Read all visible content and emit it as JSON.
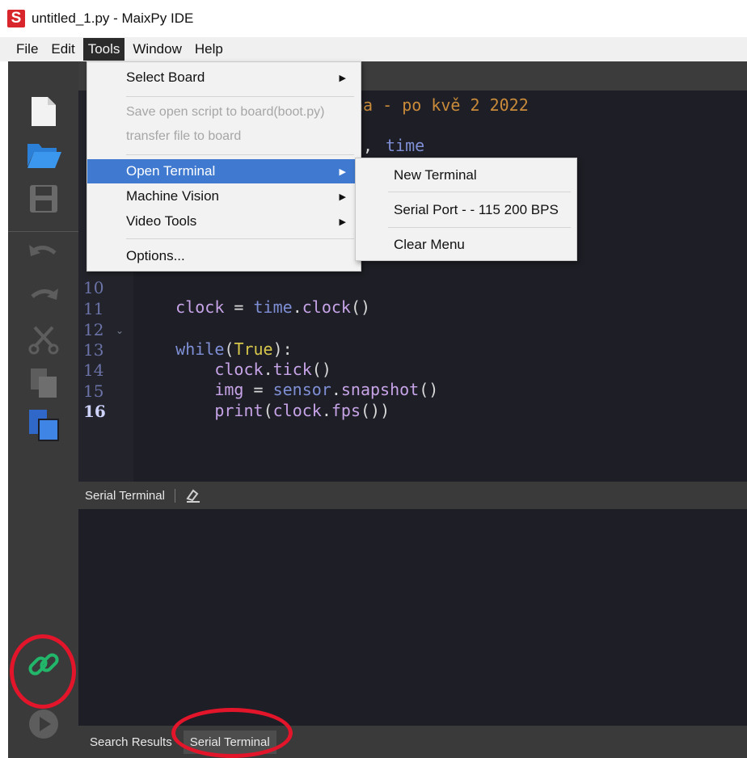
{
  "window": {
    "title": "untitled_1.py - MaixPy IDE",
    "logo_letter": "S"
  },
  "menubar": {
    "items": [
      "File",
      "Edit",
      "Tools",
      "Window",
      "Help"
    ],
    "active": "Tools"
  },
  "tools_menu": {
    "select_board": "Select Board",
    "save_script": "Save open script to board(boot.py)",
    "transfer_file": "transfer file to board",
    "open_terminal": "Open Terminal",
    "machine_vision": "Machine Vision",
    "video_tools": "Video Tools",
    "options": "Options..."
  },
  "terminal_submenu": {
    "new_terminal": "New Terminal",
    "serial_port": "Serial Port -  - 115 200 BPS",
    "clear_menu": "Clear Menu"
  },
  "editor": {
    "partial_comment": "ha - po kvě 2 2022",
    "partial_import_sep": ",",
    "partial_import_mod": "time",
    "lines": [
      {
        "num": "10",
        "text": "clock = time.clock()"
      },
      {
        "num": "11",
        "text": ""
      },
      {
        "num": "12",
        "text": "while(True):"
      },
      {
        "num": "13",
        "text": "    clock.tick()"
      },
      {
        "num": "14",
        "text": "    img = sensor.snapshot()"
      },
      {
        "num": "15",
        "text": "    print(clock.fps())"
      },
      {
        "num": "16",
        "text": ""
      }
    ],
    "colors": {
      "keyword": "#d7c64c",
      "identifier": "#c7a3e8",
      "builtin": "#7f8fd6",
      "comment": "#c98b3a",
      "punct": "#d9d9d9"
    }
  },
  "terminal_panel": {
    "title": "Serial Terminal"
  },
  "bottom_tabs": {
    "search_results": "Search Results",
    "serial_terminal": "Serial Terminal"
  },
  "toolbar_icons": [
    "new-file-icon",
    "open-folder-icon",
    "save-icon",
    "undo-icon",
    "redo-icon",
    "cut-icon",
    "copy-icon",
    "paste-icon",
    "connect-link-icon",
    "run-icon"
  ],
  "annotation_color": "#e3152a"
}
